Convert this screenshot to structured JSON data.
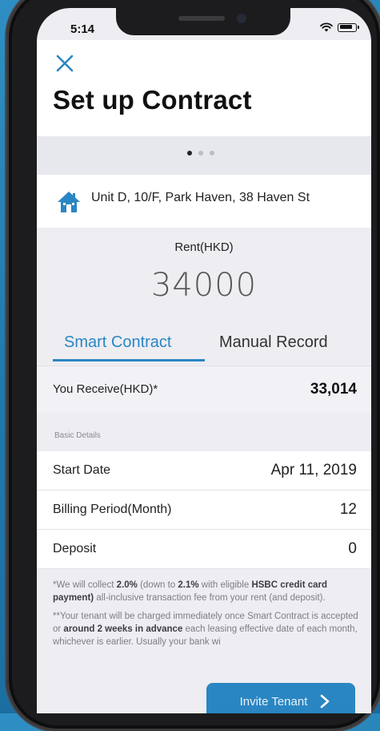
{
  "status_bar": {
    "time": "5:14"
  },
  "header": {
    "title": "Set up Contract"
  },
  "pager": {
    "total": 3,
    "active": 1
  },
  "property": {
    "address": "Unit D, 10/F, Park Haven, 38 Haven St"
  },
  "rent": {
    "label": "Rent(HKD)",
    "value": "34000"
  },
  "tabs": [
    {
      "label": "Smart Contract",
      "active": true
    },
    {
      "label": "Manual Record",
      "active": false
    }
  ],
  "receive": {
    "label": "You Receive(HKD)*",
    "value": "33,014"
  },
  "basic_details": {
    "section_label": "Basic Details",
    "rows": [
      {
        "label": "Start Date",
        "value": "Apr 11, 2019"
      },
      {
        "label": "Billing Period(Month)",
        "value": "12"
      },
      {
        "label": "Deposit",
        "value": "0"
      }
    ]
  },
  "notes": {
    "note1_pre": "*We will collect ",
    "note1_b1": "2.0%",
    "note1_mid1": " (down to ",
    "note1_b2": "2.1%",
    "note1_mid2": " with eligible ",
    "note1_b3": "HSBC credit card payment)",
    "note1_post": " all-inclusive transaction fee from your rent (and deposit).",
    "note2_pre": "**Your tenant will be charged immediately once Smart Contract is accepted or ",
    "note2_b": "around 2 weeks in advance",
    "note2_post": " each leasing effective date of each month, whichever is earlier. Usually your bank wi"
  },
  "invite_button": {
    "label": "Invite Tenant"
  },
  "colors": {
    "accent": "#2a86c2",
    "background": "#ededf2"
  },
  "icons": [
    "close-icon",
    "house-icon",
    "wifi-icon",
    "battery-icon",
    "chevron-right-icon"
  ]
}
